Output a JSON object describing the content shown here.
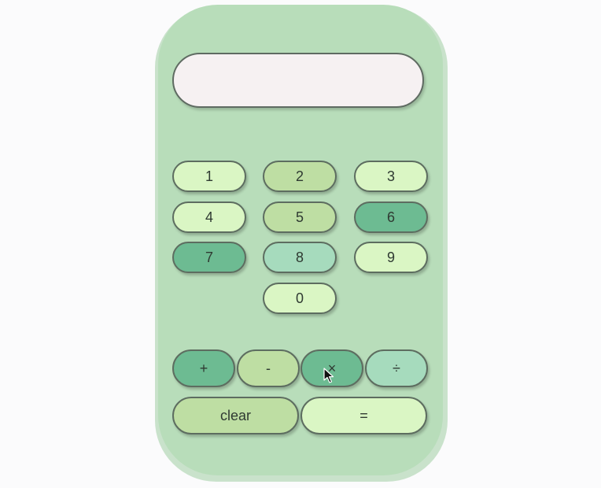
{
  "display": {
    "value": ""
  },
  "digits": [
    {
      "label": "1",
      "color": "#daf6c4"
    },
    {
      "label": "2",
      "color": "#bedea3"
    },
    {
      "label": "3",
      "color": "#daf6c4"
    },
    {
      "label": "4",
      "color": "#daf6c4"
    },
    {
      "label": "5",
      "color": "#bedea3"
    },
    {
      "label": "6",
      "color": "#6dbb92"
    },
    {
      "label": "7",
      "color": "#6dbb92"
    },
    {
      "label": "8",
      "color": "#a6dbbd"
    },
    {
      "label": "9",
      "color": "#daf6c4"
    },
    {
      "label": "0",
      "color": "#daf6c4"
    }
  ],
  "operators": [
    {
      "label": "+",
      "color": "#6dbb92"
    },
    {
      "label": "-",
      "color": "#bedea3"
    },
    {
      "label": "×",
      "color": "#6dbb92"
    },
    {
      "label": "÷",
      "color": "#a6dbbd"
    }
  ],
  "actions": {
    "clear_label": "clear",
    "equals_label": "="
  },
  "colors": {
    "body": "#b8ddba",
    "display": "#f6f1f2",
    "border": "#5d6d60"
  },
  "cursor_icon": "arrow-pointer-icon"
}
